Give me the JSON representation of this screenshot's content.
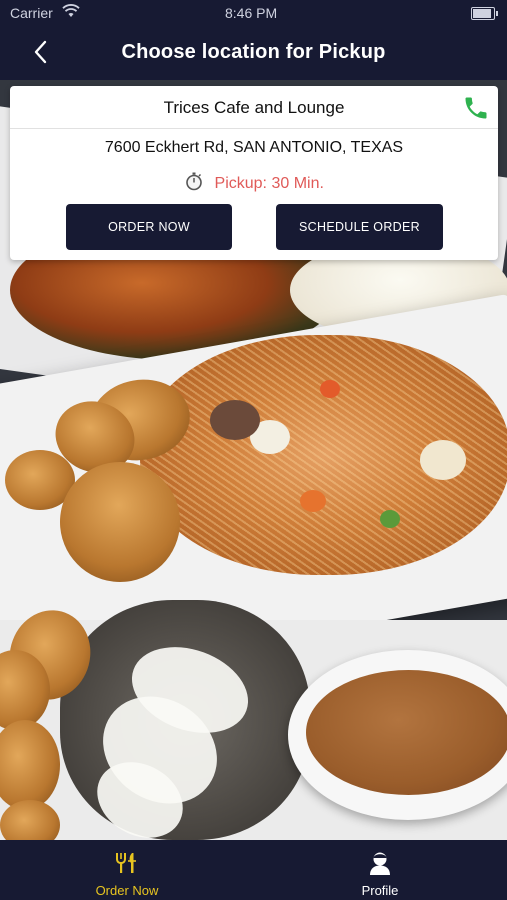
{
  "status_bar": {
    "carrier": "Carrier",
    "time": "8:46 PM"
  },
  "nav": {
    "title": "Choose location for Pickup"
  },
  "location": {
    "name": "Trices Cafe and Lounge",
    "address": "7600 Eckhert Rd, SAN ANTONIO, TEXAS",
    "pickup": "Pickup: 30 Min.",
    "order_now_label": "ORDER NOW",
    "schedule_label": "SCHEDULE ORDER"
  },
  "tabs": [
    {
      "label": "Order Now",
      "icon": "fork-knife-icon",
      "active": true
    },
    {
      "label": "Profile",
      "icon": "user-icon",
      "active": false
    }
  ],
  "colors": {
    "brand_dark": "#171a33",
    "accent_yellow": "#e7c420",
    "pickup_red": "#e05a58",
    "phone_green": "#2fb24f"
  }
}
